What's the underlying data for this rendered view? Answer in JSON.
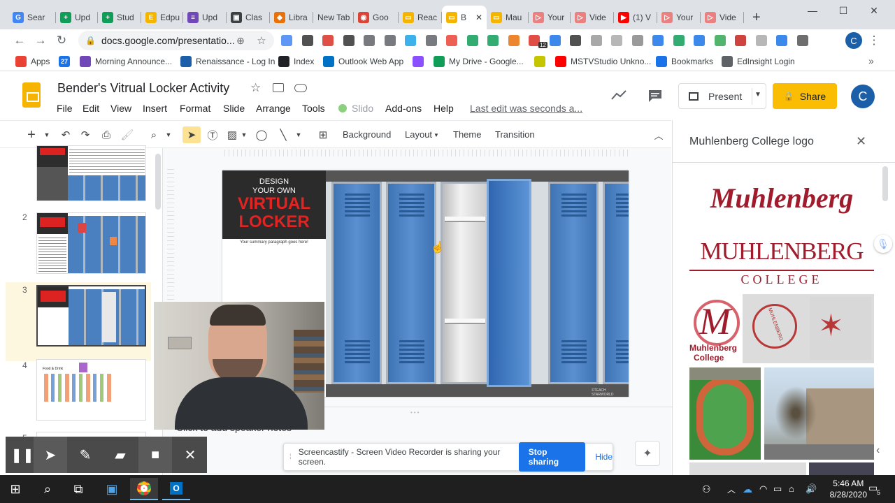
{
  "browser": {
    "tabs": [
      {
        "label": "Sear",
        "color": "#4285f4",
        "glyph": "G"
      },
      {
        "label": "Upd",
        "color": "#0f9d58",
        "glyph": "+"
      },
      {
        "label": "Stud",
        "color": "#0f9d58",
        "glyph": "+"
      },
      {
        "label": "Edpu",
        "color": "#f4b400",
        "glyph": "E"
      },
      {
        "label": "Upd",
        "color": "#7248b9",
        "glyph": "≡"
      },
      {
        "label": "Clas",
        "color": "#3c4043",
        "glyph": "▣"
      },
      {
        "label": "Libra",
        "color": "#e8710a",
        "glyph": "◆"
      },
      {
        "label": "New Tab",
        "color": "",
        "glyph": ""
      },
      {
        "label": "Goo",
        "color": "#db4437",
        "glyph": "◉"
      },
      {
        "label": "Reac",
        "color": "#f4b400",
        "glyph": "▭"
      },
      {
        "label": "B",
        "color": "#f4b400",
        "glyph": "▭"
      },
      {
        "label": "Mau",
        "color": "#f4b400",
        "glyph": "▭"
      },
      {
        "label": "Your",
        "color": "#ea8080",
        "glyph": "▷"
      },
      {
        "label": "Vide",
        "color": "#ea8080",
        "glyph": "▷"
      },
      {
        "label": "(1) V",
        "color": "#ff0000",
        "glyph": "▶"
      },
      {
        "label": "Your",
        "color": "#ea8080",
        "glyph": "▷"
      },
      {
        "label": "Vide",
        "color": "#ea8080",
        "glyph": "▷"
      }
    ],
    "active_tab_close": "✕",
    "new_tab": "+",
    "url": "docs.google.com/presentatio...",
    "bookmarks": [
      {
        "label": "Apps",
        "color": "#ea4335"
      },
      {
        "label": "",
        "color": "#1a73e8"
      },
      {
        "label": "Morning Announce...",
        "color": "#7248b9"
      },
      {
        "label": "Renaissance - Log In",
        "color": "#1a5fa8"
      },
      {
        "label": "Index",
        "color": "#202124"
      },
      {
        "label": "Outlook Web App",
        "color": "#0072c6"
      },
      {
        "label": "",
        "color": "#8a4fff"
      },
      {
        "label": "My Drive - Google...",
        "color": "#0f9d58"
      },
      {
        "label": "",
        "color": "#c5c500"
      },
      {
        "label": "MSTVStudio Unkno...",
        "color": "#ff0000"
      },
      {
        "label": "Bookmarks",
        "color": "#1a73e8"
      },
      {
        "label": "EdInsight Login",
        "color": "#5f6368"
      }
    ],
    "calendar_badge": "27",
    "ext_badge": "12",
    "profile_initial": "C"
  },
  "slides": {
    "title": "Bender's Vitrual Locker Activity",
    "menu": [
      "File",
      "Edit",
      "View",
      "Insert",
      "Format",
      "Slide",
      "Arrange",
      "Tools",
      "Slido",
      "Add-ons",
      "Help"
    ],
    "last_edit": "Last edit was seconds a...",
    "present_label": "Present",
    "share_label": "Share",
    "avatar": "C",
    "toolbar_text": {
      "background": "Background",
      "layout": "Layout",
      "theme": "Theme",
      "transition": "Transition"
    },
    "filmstrip": [
      {
        "num": "",
        "selected": false
      },
      {
        "num": "2",
        "selected": false
      },
      {
        "num": "3",
        "selected": true
      },
      {
        "num": "4",
        "selected": false
      },
      {
        "num": "5",
        "selected": false
      }
    ],
    "thumb4_text": "Food & Drink",
    "slide": {
      "design_line1": "DESIGN",
      "design_line2": "YOUR OWN",
      "virtual": "VIRTUAL",
      "locker": "LOCKER",
      "summary": "Your summary paragraph goes here!",
      "watermark": "©TEACH STARWORLD"
    },
    "speaker_notes": "Click to add speaker notes"
  },
  "panel": {
    "title": "Muhlenberg College logo",
    "close": "✕",
    "logo_script": "Muhlenberg",
    "logo_serif": "MUHLENBERG",
    "logo_sub": "COLLEGE",
    "tile1_text1": "Muhlenberg",
    "tile1_text2": "College",
    "tile2_text": "MUHLENBERG"
  },
  "screencastify": {
    "message": "Screencastify - Screen Video Recorder is sharing your screen.",
    "stop": "Stop sharing",
    "hide": "Hide"
  },
  "taskbar": {
    "time": "5:46 AM",
    "date": "8/28/2020",
    "notification_count": "5"
  }
}
